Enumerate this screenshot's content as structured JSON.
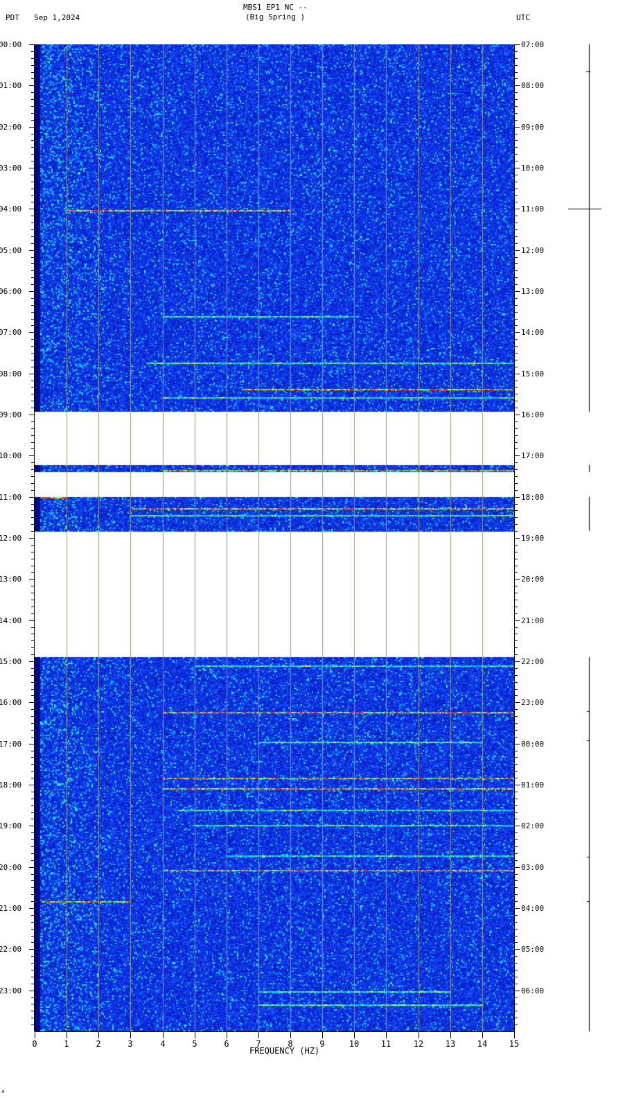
{
  "header": {
    "title": "MBS1 EP1 NC --",
    "subtitle": "(Big Spring )",
    "left_tz": "PDT",
    "date": "Sep 1,2024",
    "right_tz": "UTC"
  },
  "footer_mark": "ʌ",
  "chart_data": {
    "type": "heatmap",
    "xlabel": "FREQUENCY (HZ)",
    "xlim": [
      0,
      15
    ],
    "x_ticks": [
      "0",
      "1",
      "2",
      "3",
      "4",
      "5",
      "6",
      "7",
      "8",
      "9",
      "10",
      "11",
      "12",
      "13",
      "14",
      "15"
    ],
    "ylim_hours": [
      0,
      24
    ],
    "y_left_ticks": [
      "00:00",
      "01:00",
      "02:00",
      "03:00",
      "04:00",
      "05:00",
      "06:00",
      "07:00",
      "08:00",
      "09:00",
      "10:00",
      "11:00",
      "12:00",
      "13:00",
      "14:00",
      "15:00",
      "16:00",
      "17:00",
      "18:00",
      "19:00",
      "20:00",
      "21:00",
      "22:00",
      "23:00"
    ],
    "y_right_ticks": [
      "07:00",
      "08:00",
      "09:00",
      "10:00",
      "11:00",
      "12:00",
      "13:00",
      "14:00",
      "15:00",
      "16:00",
      "17:00",
      "18:00",
      "19:00",
      "20:00",
      "21:00",
      "22:00",
      "23:00",
      "00:00",
      "01:00",
      "02:00",
      "03:00",
      "04:00",
      "05:00",
      "06:00"
    ],
    "grid": true,
    "colormap": [
      "#00008b",
      "#0a2ee0",
      "#00c8ff",
      "#3cff7a",
      "#ffff00",
      "#ff3000",
      "#a00000"
    ],
    "background_color": "#1035e0",
    "data_segments_pdt_hours": [
      [
        0,
        8.93
      ],
      [
        10.23,
        10.4
      ],
      [
        11.0,
        11.83
      ],
      [
        14.9,
        24
      ]
    ],
    "notable_lines": [
      {
        "time_h": 4.03,
        "f_range": [
          1,
          8
        ],
        "level": "high"
      },
      {
        "time_h": 6.6,
        "f_range": [
          4,
          10
        ],
        "level": "medium"
      },
      {
        "time_h": 7.73,
        "f_range": [
          3.5,
          15
        ],
        "level": "medium"
      },
      {
        "time_h": 8.37,
        "f_range": [
          6.5,
          15
        ],
        "level": "high"
      },
      {
        "time_h": 8.58,
        "f_range": [
          4,
          15
        ],
        "level": "medium"
      },
      {
        "time_h": 10.35,
        "f_range": [
          4,
          15
        ],
        "level": "high"
      },
      {
        "time_h": 11.0,
        "f_range": [
          0.2,
          1
        ],
        "level": "high"
      },
      {
        "time_h": 11.27,
        "f_range": [
          3,
          15
        ],
        "level": "high"
      },
      {
        "time_h": 11.45,
        "f_range": [
          3,
          15
        ],
        "level": "medium"
      },
      {
        "time_h": 15.1,
        "f_range": [
          5,
          15
        ],
        "level": "medium"
      },
      {
        "time_h": 16.23,
        "f_range": [
          4,
          15
        ],
        "level": "high"
      },
      {
        "time_h": 16.95,
        "f_range": [
          7,
          14
        ],
        "level": "medium"
      },
      {
        "time_h": 17.83,
        "f_range": [
          4,
          15
        ],
        "level": "high"
      },
      {
        "time_h": 18.08,
        "f_range": [
          4,
          15
        ],
        "level": "high"
      },
      {
        "time_h": 18.6,
        "f_range": [
          4.5,
          15
        ],
        "level": "medium"
      },
      {
        "time_h": 18.97,
        "f_range": [
          5,
          15
        ],
        "level": "medium"
      },
      {
        "time_h": 19.72,
        "f_range": [
          6,
          15
        ],
        "level": "medium"
      },
      {
        "time_h": 20.08,
        "f_range": [
          4,
          15
        ],
        "level": "high"
      },
      {
        "time_h": 20.83,
        "f_range": [
          0.2,
          3
        ],
        "level": "high"
      },
      {
        "time_h": 23.02,
        "f_range": [
          7,
          13
        ],
        "level": "medium"
      },
      {
        "time_h": 23.35,
        "f_range": [
          7,
          14
        ],
        "level": "medium"
      }
    ]
  }
}
